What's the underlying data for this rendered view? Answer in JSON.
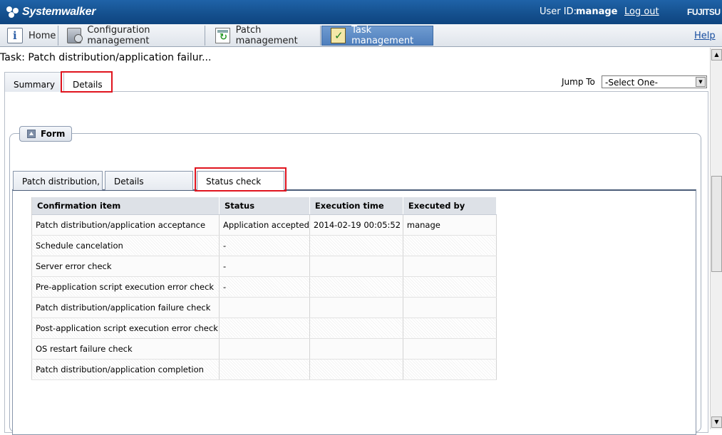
{
  "header": {
    "brand": "Systemwalker",
    "user_label": "User ID:",
    "user_name": "manage",
    "logout": "Log out",
    "vendor": "FUJITSU"
  },
  "menu": {
    "items": [
      {
        "label": "Home",
        "icon": "home-info-icon"
      },
      {
        "label": "Configuration management",
        "icon": "configuration-icon"
      },
      {
        "label": "Patch management",
        "icon": "patch-icon"
      },
      {
        "label": "Task management",
        "icon": "task-icon"
      }
    ],
    "active": "Task management",
    "help": "Help"
  },
  "page": {
    "title": "Task: Patch distribution/application failur..."
  },
  "outer_tabs": [
    "Summary",
    "Details"
  ],
  "outer_active": "Details",
  "jump_to": {
    "label": "Jump To",
    "selected": "-Select One-"
  },
  "form": {
    "legend": "Form",
    "tabs": [
      "Patch distribution,",
      "Details",
      "Status check"
    ],
    "active_tab": "Status check"
  },
  "table": {
    "columns": [
      "Confirmation item",
      "Status",
      "Execution time",
      "Executed by"
    ],
    "rows": [
      [
        "Patch distribution/application acceptance",
        "Application accepted",
        "2014-02-19 00:05:52",
        "manage"
      ],
      [
        "Schedule cancelation",
        "-",
        "",
        ""
      ],
      [
        "Server error check",
        "-",
        "",
        ""
      ],
      [
        "Pre-application script execution error check",
        "-",
        "",
        ""
      ],
      [
        "Patch distribution/application failure check",
        "",
        "",
        ""
      ],
      [
        "Post-application script execution error check",
        "",
        "",
        ""
      ],
      [
        "OS restart failure check",
        "",
        "",
        ""
      ],
      [
        "Patch distribution/application completion",
        "",
        "",
        ""
      ]
    ]
  },
  "colors": {
    "header_bg": "#1a5a9c",
    "active_menu": "#5a87c4",
    "highlight": "#e0141e"
  }
}
